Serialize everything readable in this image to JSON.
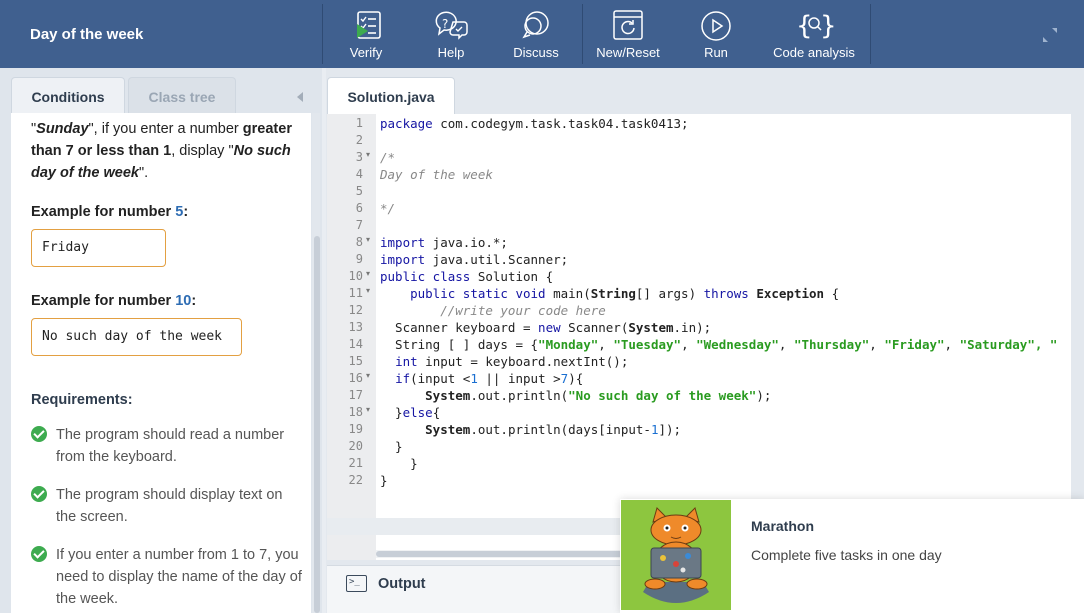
{
  "header": {
    "title": "Day of the week",
    "colors": {
      "bar": "#40608f",
      "accent_green": "#3dab4f"
    },
    "actions": [
      {
        "id": "verify",
        "label": "Verify",
        "icon": "verify-icon"
      },
      {
        "id": "help",
        "label": "Help",
        "icon": "help-icon"
      },
      {
        "id": "discuss",
        "label": "Discuss",
        "icon": "discuss-icon"
      },
      {
        "id": "reset",
        "label": "New/Reset",
        "icon": "reset-icon"
      },
      {
        "id": "run",
        "label": "Run",
        "icon": "run-icon"
      },
      {
        "id": "analysis",
        "label": "Code analysis",
        "icon": "code-analysis-icon"
      }
    ]
  },
  "left": {
    "tabs": {
      "conditions": "Conditions",
      "class_tree": "Class tree"
    },
    "conditions": {
      "p1": "\"",
      "p1_sunday": "Sunday",
      "p1_mid": "\", if you enter a number ",
      "p1_bold": "greater than 7 or less than 1",
      "p1_mid2": ", display \"",
      "p1_nosuch": "No such day of the week",
      "p1_end": "\".",
      "ex1_prefix": "Example for number ",
      "ex1_num": "5",
      "ex1_suffix": ":",
      "ex1_value": "Friday",
      "ex2_prefix": "Example for number ",
      "ex2_num": "10",
      "ex2_suffix": ":",
      "ex2_value": "No such day of the week",
      "req_title": "Requirements:",
      "requirements": [
        "The program should read a number from the keyboard.",
        "The program should display text on the screen.",
        "If you enter a number from 1 to 7, you need to display the name of the day of the week."
      ]
    }
  },
  "editor": {
    "file_tab": "Solution.java",
    "lines": {
      "l1_k": "package",
      "l1_r": " com.codegym.task.task04.task0413;",
      "l3": "/*",
      "l4": "Day of the week",
      "l6": "*/",
      "l8_k": "import",
      "l8_r": " java.io.*;",
      "l9_k": "import",
      "l9_r": " java.util.Scanner;",
      "l10_k": "public class",
      "l10_r": " Solution {",
      "l11_a": "    ",
      "l11_k": "public static void",
      "l11_b": " main(",
      "l11_t": "String",
      "l11_c": "[] args) ",
      "l11_k2": "throws",
      "l11_d": " ",
      "l11_t2": "Exception",
      "l11_e": " {",
      "l12": "        //write your code here",
      "l13_a": "  Scanner keyboard = ",
      "l13_k": "new",
      "l13_b": " Scanner(",
      "l13_t": "System",
      "l13_c": ".in);",
      "l14_a": "  String [ ] days = {",
      "l14_s1": "\"Monday\"",
      "l14_s2": "\"Tuesday\"",
      "l14_s3": "\"Wednesday\"",
      "l14_s4": "\"Thursday\"",
      "l14_s5": "\"Friday\"",
      "l14_s6": "\"Saturday\"",
      "l14_sep": ", ",
      "l14_tail": ", \"",
      "l15_a": "  ",
      "l15_k": "int",
      "l15_b": " input = keyboard.nextInt();",
      "l16_a": "  ",
      "l16_k": "if",
      "l16_b": "(input <",
      "l16_n1": "1",
      "l16_c": " || input >",
      "l16_n2": "7",
      "l16_d": "){",
      "l17_a": "      ",
      "l17_t": "System",
      "l17_b": ".out.println(",
      "l17_s": "\"No such day of the week\"",
      "l17_c": ");",
      "l18_a": "  }",
      "l18_k": "else",
      "l18_b": "{",
      "l19_a": "      ",
      "l19_t": "System",
      "l19_b": ".out.println(days[input-",
      "l19_n": "1",
      "l19_c": "]);",
      "l20": "  }",
      "l21": "    }",
      "l22": "}"
    },
    "line_numbers": [
      "1",
      "2",
      "3",
      "4",
      "5",
      "6",
      "7",
      "8",
      "9",
      "10",
      "11",
      "12",
      "13",
      "14",
      "15",
      "16",
      "17",
      "18",
      "19",
      "20",
      "21",
      "22"
    ],
    "fold_mark": "▾"
  },
  "output": {
    "label": "Output",
    "icon_text": ">_"
  },
  "toast": {
    "title": "Marathon",
    "text": "Complete five tasks in one day"
  }
}
